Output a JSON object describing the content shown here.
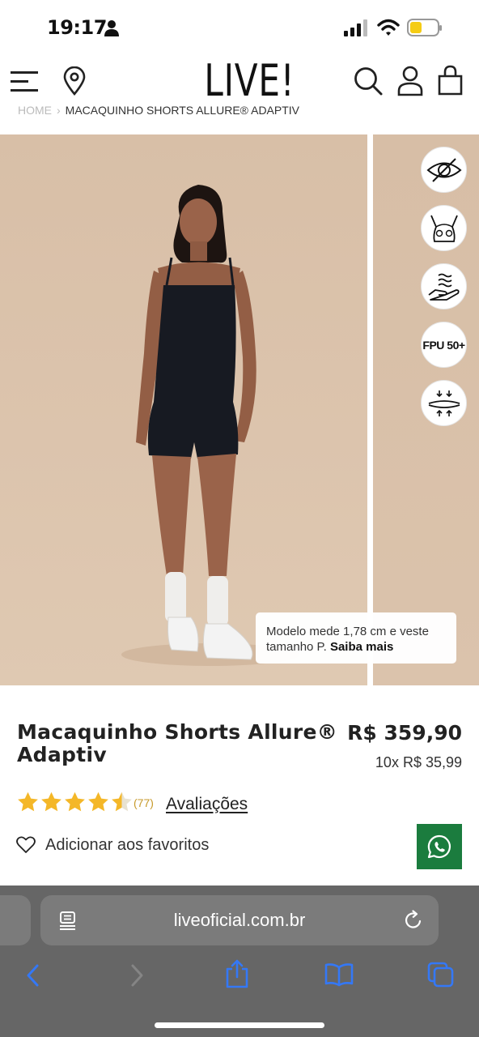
{
  "status_bar": {
    "time": "19:17"
  },
  "header": {
    "logo": "LIVE!"
  },
  "breadcrumb": {
    "home": "HOME",
    "separator": "›",
    "current": "MACAQUINHO SHORTS ALLURE® ADAPTIV"
  },
  "gallery": {
    "feature_icons": [
      "eye-slash-icon",
      "bra-cup-icon",
      "hand-waves-icon",
      "fpu-50-icon",
      "compression-icon"
    ],
    "fpu_label": "FPU 50+",
    "tooltip_text": "Modelo mede 1,78 cm e veste tamanho P.",
    "tooltip_link": "Saiba mais"
  },
  "product": {
    "title": "Macaquinho Shorts Allure® Adaptiv",
    "price": "R$ 359,90",
    "installments": "10x R$ 35,99",
    "rating": 4.5,
    "review_count": "(77)",
    "reviews_link": "Avaliações",
    "favorite_label": "Adicionar aos favoritos"
  },
  "browser": {
    "url": "liveoficial.com.br"
  },
  "colors": {
    "whatsapp_green": "#1b7c3e",
    "star_gold": "#f4b728",
    "browser_accent": "#3478f6"
  }
}
